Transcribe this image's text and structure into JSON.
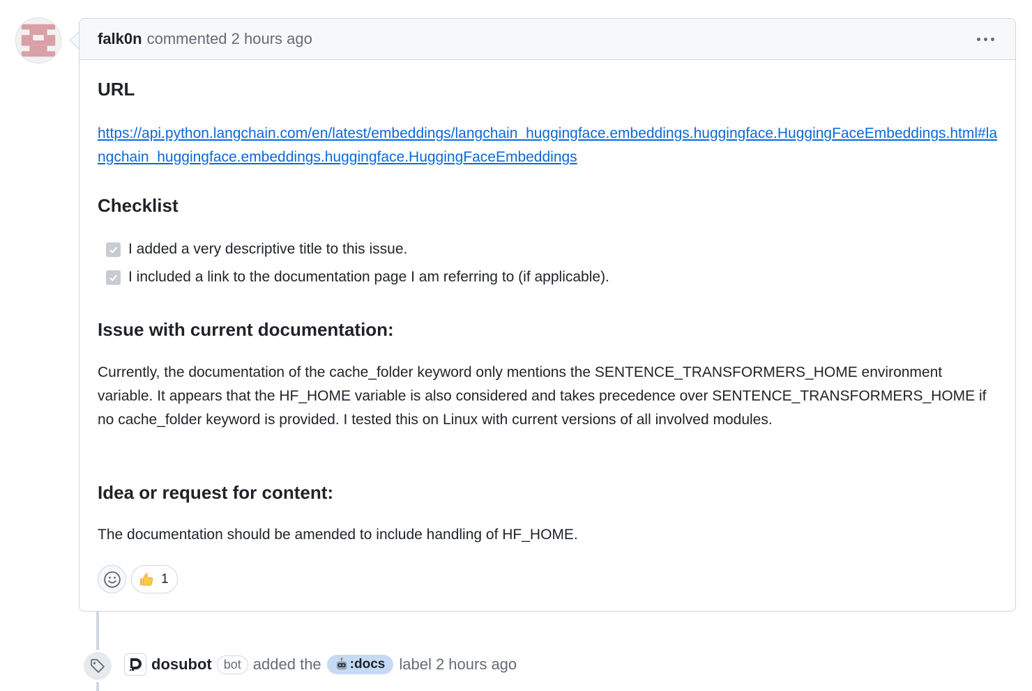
{
  "comment": {
    "author": "falk0n",
    "meta": "commented 2 hours ago",
    "menu_icon": "kebab-horizontal-icon",
    "sections": {
      "url_heading": "URL",
      "url": "https://api.python.langchain.com/en/latest/embeddings/langchain_huggingface.embeddings.huggingface.HuggingFaceEmbeddings.html#langchain_huggingface.embeddings.huggingface.HuggingFaceEmbeddings",
      "checklist_heading": "Checklist",
      "checklist_items": [
        {
          "label": "I added a very descriptive title to this issue.",
          "checked": true
        },
        {
          "label": "I included a link to the documentation page I am referring to (if applicable).",
          "checked": true
        }
      ],
      "issue_heading": "Issue with current documentation:",
      "issue_text": "Currently, the documentation of the cache_folder keyword only mentions the SENTENCE_TRANSFORMERS_HOME environment variable. It appears that the HF_HOME variable is also considered and takes precedence over SENTENCE_TRANSFORMERS_HOME if no cache_folder keyword is provided. I tested this on Linux with current versions of all involved modules.",
      "idea_heading": "Idea or request for content:",
      "idea_text": "The documentation should be amended to include handling of HF_HOME."
    },
    "reactions": {
      "add_icon": "smiley-icon",
      "items": [
        {
          "emoji": "thumbs-up-icon",
          "count": "1"
        }
      ]
    }
  },
  "event": {
    "icon": "tag-icon",
    "actor": "dosubot",
    "badge": "bot",
    "action": "added the",
    "label": ":docs",
    "label_icon": "robot-icon",
    "label_color": "#c5daf5",
    "suffix": "label 2 hours ago"
  },
  "colors": {
    "link": "#0969da",
    "text": "#1f2328",
    "muted": "#636c76",
    "border": "#d0d7de"
  }
}
